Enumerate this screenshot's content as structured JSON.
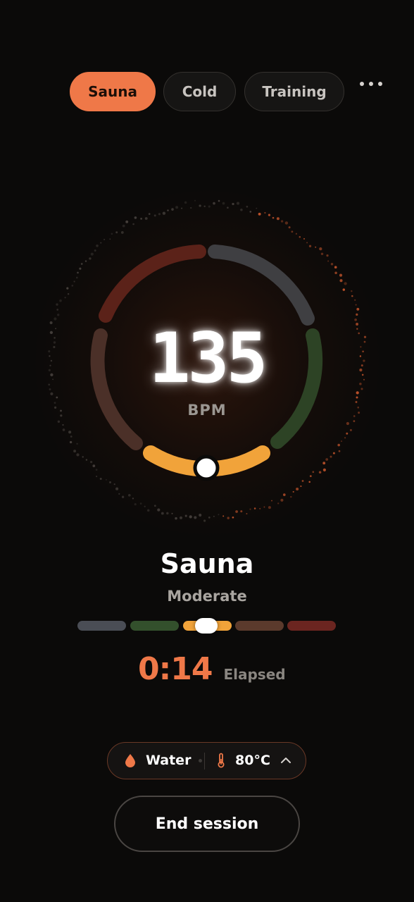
{
  "tabs": [
    {
      "label": "Sauna",
      "active": true
    },
    {
      "label": "Cold",
      "active": false
    },
    {
      "label": "Training",
      "active": false
    }
  ],
  "more_icon": "more-horizontal-icon",
  "heart_rate": {
    "value": "135",
    "unit": "BPM"
  },
  "zone_colors": [
    "#4a4d55",
    "#33502c",
    "#f1a33a",
    "#5b3a2c",
    "#6b2520"
  ],
  "current_zone_index": 2,
  "mode": {
    "title": "Sauna",
    "intensity": "Moderate"
  },
  "timer": {
    "value": "0:14",
    "label": "Elapsed"
  },
  "settings_chip": {
    "water_icon": "water-drop-icon",
    "water_label": "Water",
    "temp_icon": "thermometer-icon",
    "temp_label": "80°C",
    "expand_icon": "chevron-up-icon"
  },
  "end_button": {
    "label": "End session"
  },
  "accent_color": "#ef7848"
}
